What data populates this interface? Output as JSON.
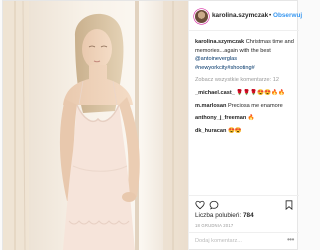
{
  "profile": {
    "username": "karolina.szymczak",
    "separator": "•",
    "follow_label": "Obserwuj"
  },
  "caption": {
    "username": "karolina.szymczak",
    "text_1": "Christmas time and memories...again with the best",
    "mention": "@antoineverglas",
    "hashtags": "#newyorkcity#shooting#"
  },
  "view_all_label": "Zobacz wszystkie komentarze: 12",
  "comments": [
    {
      "username": "_michael.cast_",
      "text": "🌹🌹🌹😍😍🔥🔥"
    },
    {
      "username": "m.marlosan",
      "text": "Preciosa me enamore"
    },
    {
      "username": "anthony_j_freeman",
      "text": "🔥"
    },
    {
      "username": "dk_huracan",
      "text": "😍😍"
    }
  ],
  "likes": {
    "label": "Liczba polubień:",
    "count": "784"
  },
  "date": "18 GRUDNIA 2017",
  "add_comment_placeholder": "Dodaj komentarz...",
  "more_label": "•••",
  "icons": [
    "heart-icon",
    "comment-icon",
    "bookmark-icon",
    "more-icon"
  ],
  "colors": {
    "link": "#3897f0",
    "hashtag": "#003569",
    "border": "#efefef",
    "muted": "#999999"
  }
}
